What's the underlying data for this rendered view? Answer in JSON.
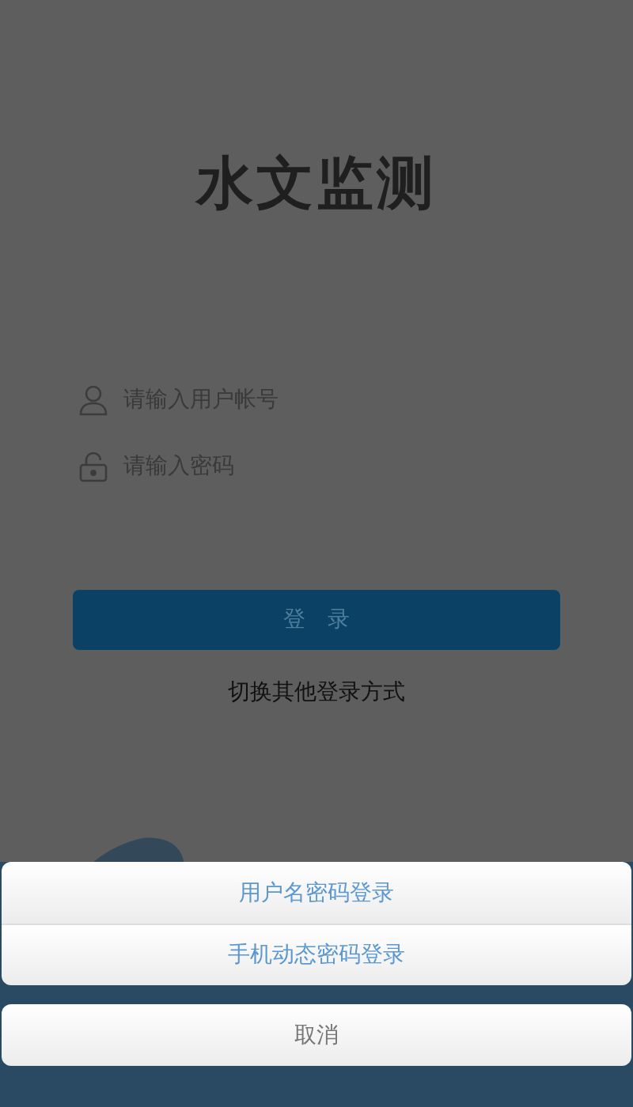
{
  "app_title": "水文监测",
  "fields": [
    {
      "kind": "user",
      "placeholder": "请输入用户帐号"
    },
    {
      "kind": "password",
      "placeholder": "请输入密码"
    }
  ],
  "login_button": "登　录",
  "switch_link": "切换其他登录方式",
  "action_sheet": {
    "options": [
      "用户名密码登录",
      "手机动态密码登录"
    ],
    "cancel": "取消"
  }
}
